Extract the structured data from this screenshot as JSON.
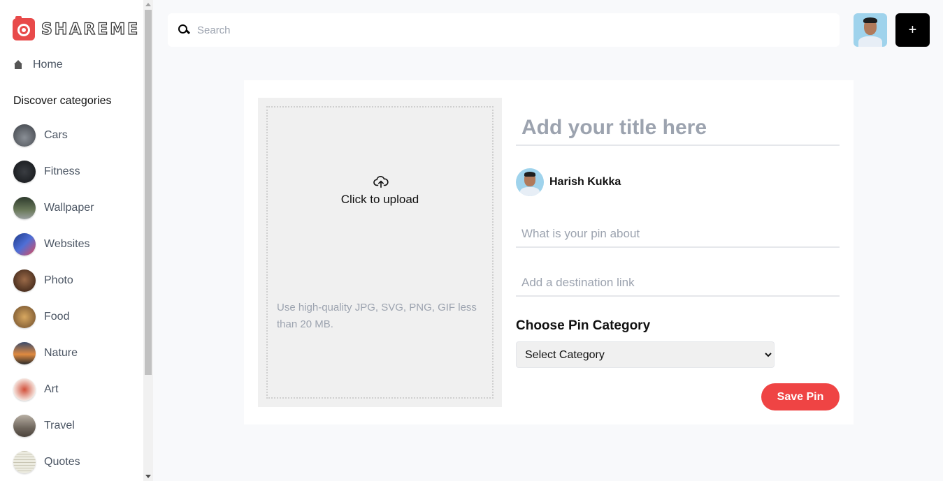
{
  "brand": {
    "name": "SHAREME",
    "accent": "#e84a4a"
  },
  "sidebar": {
    "home_label": "Home",
    "discover_label": "Discover categories",
    "categories": [
      {
        "label": "Cars",
        "thumb": "#5b5f66"
      },
      {
        "label": "Fitness",
        "thumb": "#1f2226"
      },
      {
        "label": "Wallpaper",
        "thumb": "#3b4a3a"
      },
      {
        "label": "Websites",
        "thumb": "#2f4fa8"
      },
      {
        "label": "Photo",
        "thumb": "#5a3522"
      },
      {
        "label": "Food",
        "thumb": "#a0763d"
      },
      {
        "label": "Nature",
        "thumb": "#c0703a"
      },
      {
        "label": "Art",
        "thumb": "#e8c4bc"
      },
      {
        "label": "Travel",
        "thumb": "#8a8278"
      },
      {
        "label": "Quotes",
        "thumb": "#e6e4d8"
      }
    ]
  },
  "search": {
    "placeholder": "Search"
  },
  "topbar": {
    "add_label": "+"
  },
  "form": {
    "upload_label": "Click to upload",
    "upload_hint": "Use high-quality JPG, SVG, PNG, GIF less than 20 MB.",
    "title_placeholder": "Add your title here",
    "user_name": "Harish Kukka",
    "about_placeholder": "What is your pin about",
    "link_placeholder": "Add a destination link",
    "category_label": "Choose Pin Category",
    "category_selected": "Select Category",
    "save_label": "Save Pin",
    "save_color": "#ef4444"
  }
}
